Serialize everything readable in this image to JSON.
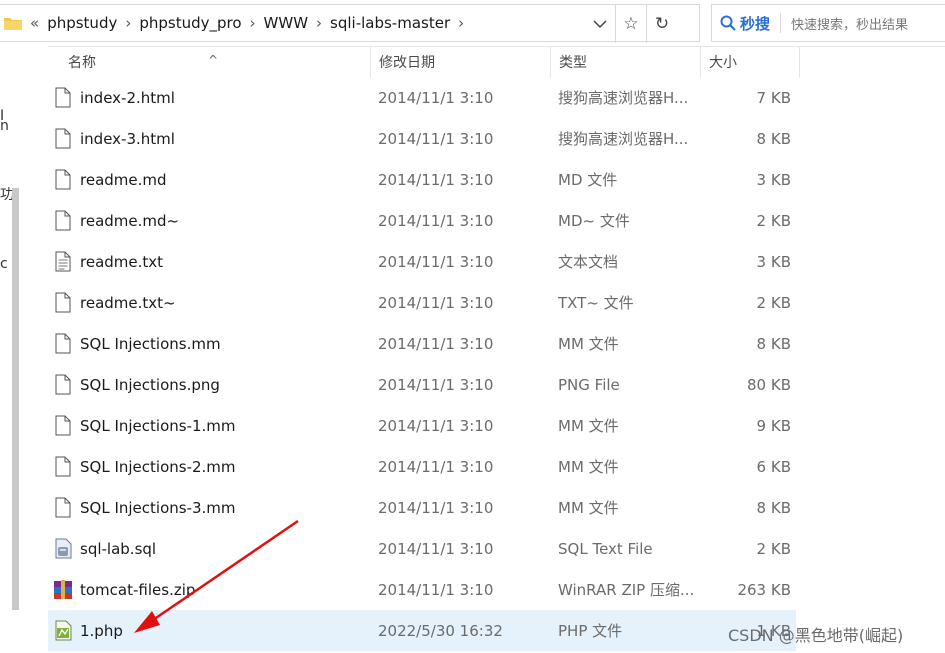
{
  "address_bar": {
    "breadcrumbs": [
      "phpstudy",
      "phpstudy_pro",
      "WWW",
      "sqli-labs-master"
    ],
    "overflow_glyph": "«"
  },
  "search": {
    "button_label": "秒搜",
    "placeholder": "快速搜索，秒出结果"
  },
  "nav_fragments": [
    "I",
    "n",
    "功",
    "c"
  ],
  "columns": {
    "name": "名称",
    "date": "修改日期",
    "type": "类型",
    "size": "大小"
  },
  "files": [
    {
      "name": "index-2.html",
      "date": "2014/11/1 3:10",
      "type": "搜狗高速浏览器H...",
      "size": "7 KB",
      "icon": "document-icon"
    },
    {
      "name": "index-3.html",
      "date": "2014/11/1 3:10",
      "type": "搜狗高速浏览器H...",
      "size": "8 KB",
      "icon": "document-icon"
    },
    {
      "name": "readme.md",
      "date": "2014/11/1 3:10",
      "type": "MD 文件",
      "size": "3 KB",
      "icon": "document-icon"
    },
    {
      "name": "readme.md~",
      "date": "2014/11/1 3:10",
      "type": "MD~ 文件",
      "size": "2 KB",
      "icon": "document-icon"
    },
    {
      "name": "readme.txt",
      "date": "2014/11/1 3:10",
      "type": "文本文档",
      "size": "3 KB",
      "icon": "text-file-icon"
    },
    {
      "name": "readme.txt~",
      "date": "2014/11/1 3:10",
      "type": "TXT~ 文件",
      "size": "2 KB",
      "icon": "document-icon"
    },
    {
      "name": "SQL Injections.mm",
      "date": "2014/11/1 3:10",
      "type": "MM 文件",
      "size": "8 KB",
      "icon": "document-icon"
    },
    {
      "name": "SQL Injections.png",
      "date": "2014/11/1 3:10",
      "type": "PNG File",
      "size": "80 KB",
      "icon": "document-icon"
    },
    {
      "name": "SQL Injections-1.mm",
      "date": "2014/11/1 3:10",
      "type": "MM 文件",
      "size": "9 KB",
      "icon": "document-icon"
    },
    {
      "name": "SQL Injections-2.mm",
      "date": "2014/11/1 3:10",
      "type": "MM 文件",
      "size": "6 KB",
      "icon": "document-icon"
    },
    {
      "name": "SQL Injections-3.mm",
      "date": "2014/11/1 3:10",
      "type": "MM 文件",
      "size": "8 KB",
      "icon": "document-icon"
    },
    {
      "name": "sql-lab.sql",
      "date": "2014/11/1 3:10",
      "type": "SQL Text File",
      "size": "2 KB",
      "icon": "sql-file-icon"
    },
    {
      "name": "tomcat-files.zip",
      "date": "2014/11/1 3:10",
      "type": "WinRAR ZIP 压缩...",
      "size": "263 KB",
      "icon": "winrar-archive-icon"
    },
    {
      "name": "1.php",
      "date": "2022/5/30 16:32",
      "type": "PHP 文件",
      "size": "1 KB",
      "icon": "php-file-icon",
      "selected": true
    }
  ],
  "watermark": "CSDN @黑色地带(崛起)",
  "colors": {
    "selection": "#e5f1fb",
    "arrow": "#e01010",
    "accent": "#2b6fd6"
  }
}
